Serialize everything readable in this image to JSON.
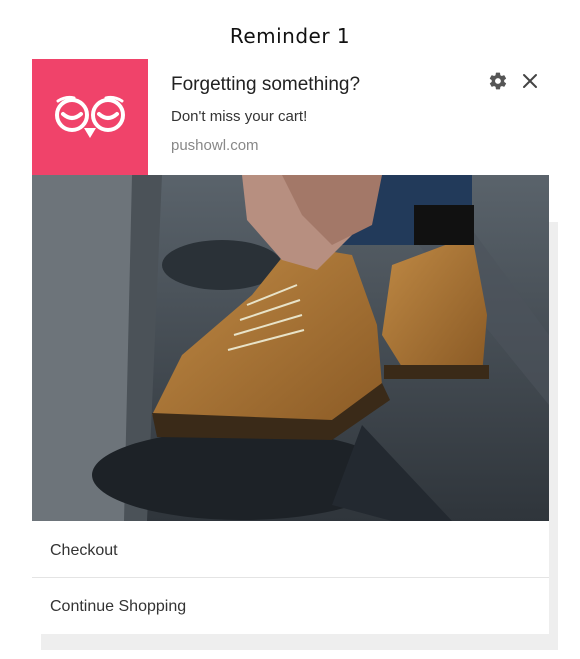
{
  "page": {
    "heading": "Reminder 1"
  },
  "notification": {
    "title": "Forgetting something?",
    "body": "Don't miss your cart!",
    "domain": "pushowl.com",
    "brand_color": "#f0436a",
    "icons": {
      "logo": "owl-logo-icon",
      "settings": "gear-icon",
      "close": "close-icon"
    },
    "image": {
      "subject": "boot-lacing-photo"
    },
    "actions": [
      {
        "label": "Checkout"
      },
      {
        "label": "Continue Shopping"
      }
    ]
  }
}
